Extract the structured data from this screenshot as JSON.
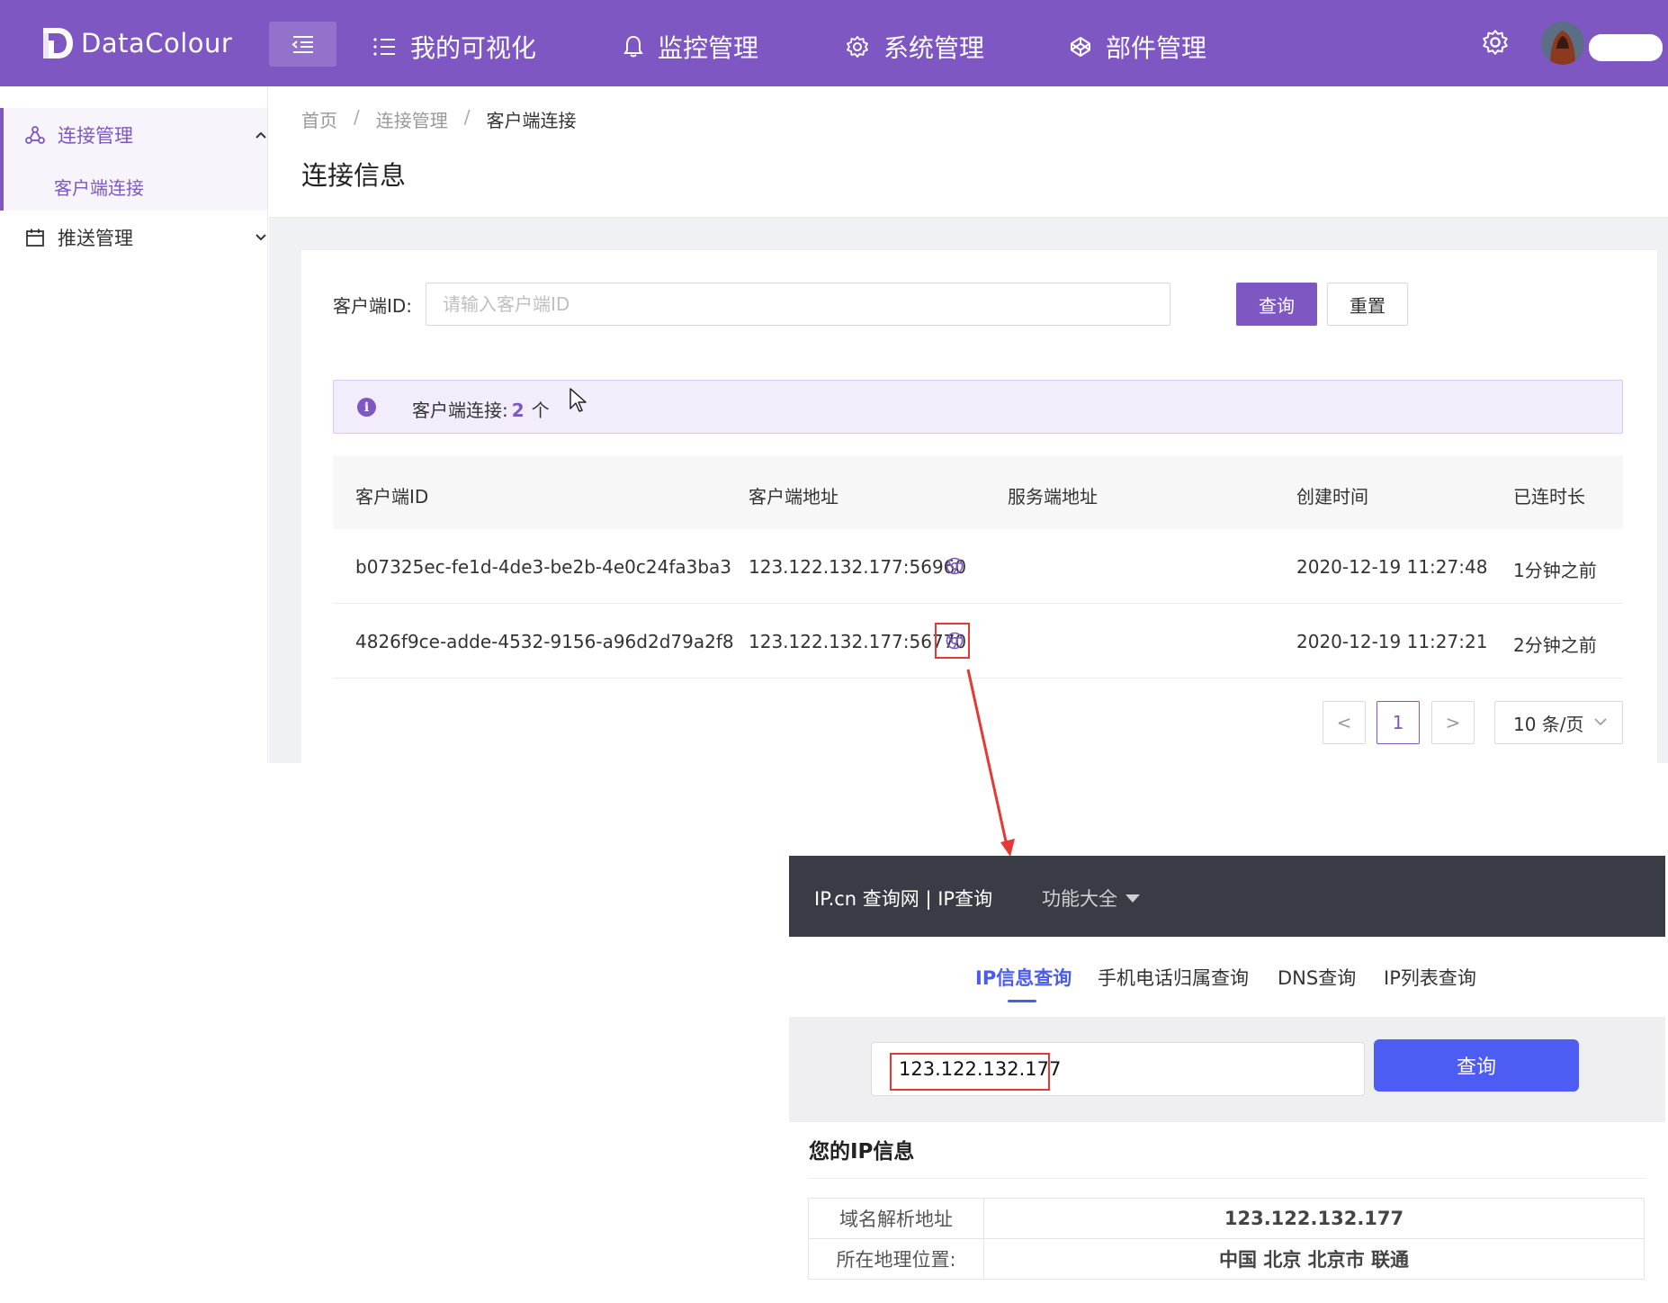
{
  "app": {
    "logo_text": "DataColour"
  },
  "topnav": {
    "items": [
      {
        "label": "我的可视化",
        "icon": "list-icon"
      },
      {
        "label": "监控管理",
        "icon": "bell-icon"
      },
      {
        "label": "系统管理",
        "icon": "gear-icon"
      },
      {
        "label": "部件管理",
        "icon": "codepen-icon"
      }
    ]
  },
  "sidebar": {
    "items": [
      {
        "label": "连接管理",
        "icon": "cluster-icon",
        "expanded": true,
        "children": [
          {
            "label": "客户端连接",
            "active": true
          }
        ]
      },
      {
        "label": "推送管理",
        "icon": "calendar-icon",
        "expanded": false
      }
    ]
  },
  "breadcrumb": [
    "首页",
    "连接管理",
    "客户端连接"
  ],
  "page_title": "连接信息",
  "search": {
    "label": "客户端ID:",
    "placeholder": "请输入客户端ID",
    "value": "",
    "query_label": "查询",
    "reset_label": "重置"
  },
  "alert": {
    "text": "客户端连接:",
    "count": "2",
    "unit": "个"
  },
  "table": {
    "columns": [
      "客户端ID",
      "客户端地址",
      "服务端地址",
      "创建时间",
      "已连时长"
    ],
    "rows": [
      {
        "client_id": "b07325ec-fe1d-4de3-be2b-4e0c24fa3ba3",
        "client_addr": "123.122.132.177:56960",
        "server_addr": "",
        "created": "2020-12-19 11:27:48",
        "duration": "1分钟之前"
      },
      {
        "client_id": "4826f9ce-adde-4532-9156-a96d2d79a2f8",
        "client_addr": "123.122.132.177:56770",
        "server_addr": "",
        "created": "2020-12-19 11:27:21",
        "duration": "2分钟之前"
      }
    ]
  },
  "pagination": {
    "prev": "<",
    "current": "1",
    "next": ">",
    "page_size": "10 条/页"
  },
  "ip_site": {
    "brand": "IP.cn 查询网 | IP查询",
    "func_menu": "功能大全",
    "tabs": [
      "IP信息查询",
      "手机电话归属查询",
      "DNS查询",
      "IP列表查询"
    ],
    "active_tab": "IP信息查询",
    "input_value": "123.122.132.177",
    "query_label": "查询",
    "info_title": "您的IP信息",
    "info_rows": [
      {
        "key": "域名解析地址",
        "value": "123.122.132.177"
      },
      {
        "key": "所在地理位置:",
        "value": "中国 北京 北京市 联通"
      }
    ]
  },
  "colors": {
    "brand_purple": "#7e57c2",
    "ip_blue": "#4d5cf3",
    "ip_dark": "#393c45",
    "highlight_red": "#e53935"
  }
}
